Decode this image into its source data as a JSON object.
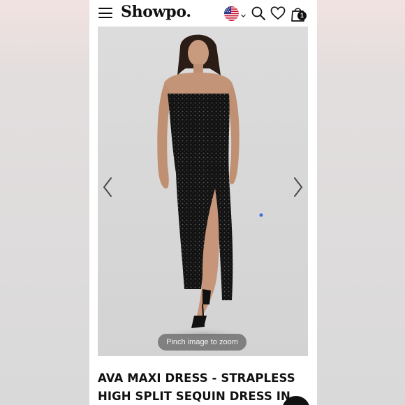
{
  "brand": {
    "logo_text": "Showpo."
  },
  "header": {
    "menu_icon": "hamburger-menu-icon",
    "region_icon": "us-flag-icon",
    "region_dropdown_icon": "chevron-down-icon",
    "search_icon": "search-icon",
    "wishlist_icon": "heart-icon",
    "cart_icon": "shopping-bag-icon",
    "cart_count": "1"
  },
  "gallery": {
    "prev_icon": "chevron-left-icon",
    "next_icon": "chevron-right-icon",
    "zoom_hint": "Pinch image to zoom"
  },
  "product": {
    "title": "AVA MAXI DRESS - STRAPLESS HIGH SPLIT SEQUIN DRESS IN BLACK"
  },
  "colors": {
    "text": "#111111",
    "background": "#ffffff",
    "zoom_pill": "#5f5f5f"
  }
}
